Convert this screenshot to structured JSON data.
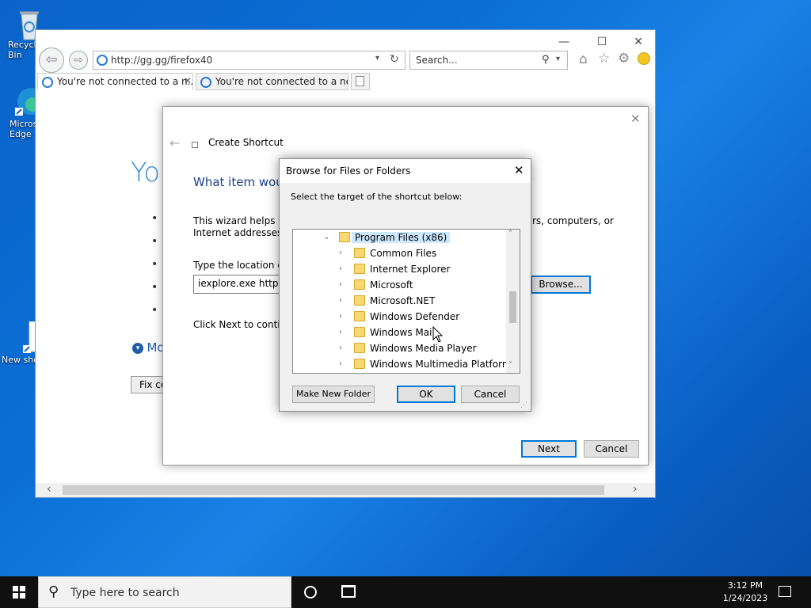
{
  "desktop": {
    "icons": [
      {
        "label": "Recycle Bin"
      },
      {
        "label": "Microsoft Edge"
      },
      {
        "label": "New shortcut"
      }
    ]
  },
  "browser": {
    "address": "http://gg.gg/firefox40",
    "search_placeholder": "Search...",
    "tabs": [
      {
        "label": "You're not connected to a n..."
      },
      {
        "label": "You're not connected to a net..."
      }
    ],
    "page_heading": "Yo",
    "page_link": "Mo",
    "page_button": "Fix co"
  },
  "wizard": {
    "title": "Create Shortcut",
    "heading": "What item woul",
    "desc_left": "This wizard helps you",
    "desc_left2": "Internet addresses.",
    "desc_right": "rs, computers, or",
    "location_label": "Type the location of t",
    "location_value": "iexplore.exe http://",
    "browse_label": "Browse...",
    "continue_text": "Click Next to continu",
    "next_label": "Next",
    "cancel_label": "Cancel"
  },
  "browse_dialog": {
    "title": "Browse for Files or Folders",
    "instruction": "Select the target of the shortcut below:",
    "tree": [
      {
        "label": "Program Files (x86)",
        "expanded": true,
        "selected": true
      },
      {
        "label": "Common Files"
      },
      {
        "label": "Internet Explorer"
      },
      {
        "label": "Microsoft"
      },
      {
        "label": "Microsoft.NET"
      },
      {
        "label": "Windows Defender"
      },
      {
        "label": "Windows Mail"
      },
      {
        "label": "Windows Media Player"
      },
      {
        "label": "Windows Multimedia Platform"
      }
    ],
    "new_folder_label": "Make New Folder",
    "ok_label": "OK",
    "cancel_label": "Cancel"
  },
  "taskbar": {
    "search_placeholder": "Type here to search",
    "time": "3:12 PM",
    "date": "1/24/2023"
  },
  "colors": {
    "accent": "#0078d7",
    "link_blue": "#1f5da8",
    "selection": "#cce8ff"
  }
}
